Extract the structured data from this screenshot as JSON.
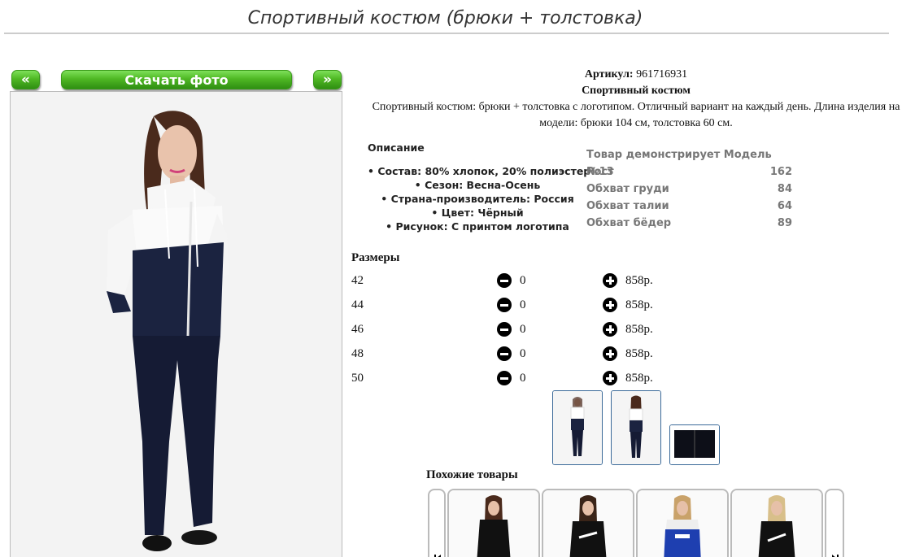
{
  "page": {
    "title": "Спортивный костюм (брюки + толстовка)"
  },
  "gallery": {
    "prev_label": "«",
    "download_label": "Скачать фото",
    "next_label": "»"
  },
  "product": {
    "article_label": "Артикул:",
    "article_value": "961716931",
    "name": "Спортивный костюм",
    "description": "Спортивный костюм: брюки + толстовка с логотипом. Отличный вариант на каждый день. Длина изделия на модели: брюки 104 см, толстовка 60 см."
  },
  "details": {
    "title": "Описание",
    "items": [
      "Состав: 80% хлопок, 20% полиэстер",
      "Сезон: Весна-Осень",
      "Страна-производитель: Россия",
      "Цвет: Чёрный",
      "Рисунок: С принтом логотипа"
    ]
  },
  "model": {
    "heading": "Товар демонстрирует Модель №13",
    "rows": [
      {
        "label": "Рост",
        "value": "162"
      },
      {
        "label": "Обхват груди",
        "value": "84"
      },
      {
        "label": "Обхват талии",
        "value": "64"
      },
      {
        "label": "Обхват бёдер",
        "value": "89"
      }
    ]
  },
  "sizes": {
    "title": "Размеры",
    "rows": [
      {
        "size": "42",
        "qty": "0",
        "price": "858р."
      },
      {
        "size": "44",
        "qty": "0",
        "price": "858р."
      },
      {
        "size": "46",
        "qty": "0",
        "price": "858р."
      },
      {
        "size": "48",
        "qty": "0",
        "price": "858р."
      },
      {
        "size": "50",
        "qty": "0",
        "price": "858р."
      }
    ]
  },
  "similar": {
    "title": "Похожие товары"
  },
  "colors": {
    "accent_green": "#4fb824",
    "thumb_border": "#3b6a99",
    "navy": "#1b2340"
  },
  "icons": {
    "minus": "minus-circle-icon",
    "plus": "plus-circle-icon"
  }
}
